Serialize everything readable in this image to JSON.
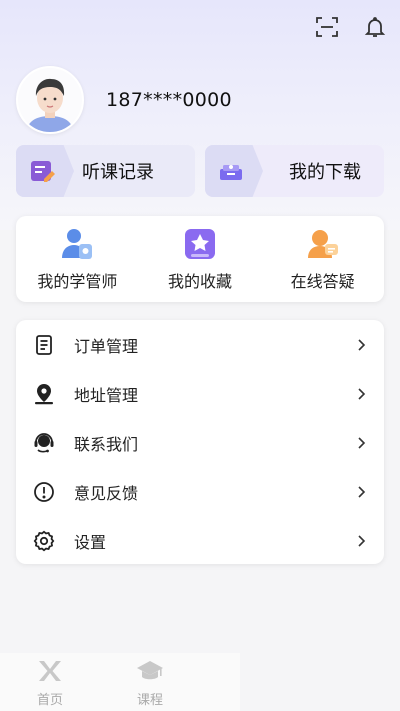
{
  "header": {
    "phone": "187****0000"
  },
  "quick_actions": [
    {
      "label": "听课记录",
      "icon": "listening-record-icon"
    },
    {
      "label": "我的下载",
      "icon": "download-box-icon"
    }
  ],
  "features": [
    {
      "label": "我的学管师",
      "icon": "tutor-icon"
    },
    {
      "label": "我的收藏",
      "icon": "favorites-star-icon"
    },
    {
      "label": "在线答疑",
      "icon": "online-qa-icon"
    }
  ],
  "menu": [
    {
      "label": "订单管理",
      "icon": "document-icon"
    },
    {
      "label": "地址管理",
      "icon": "location-icon"
    },
    {
      "label": "联系我们",
      "icon": "headset-icon"
    },
    {
      "label": "意见反馈",
      "icon": "exclamation-circle-icon"
    },
    {
      "label": "设置",
      "icon": "gear-icon"
    }
  ],
  "tabbar": [
    {
      "label": "首页",
      "icon": "home-logo-icon"
    },
    {
      "label": "课程",
      "icon": "graduation-cap-icon"
    }
  ],
  "colors": {
    "accent": "#7b6bef",
    "orange": "#f59a3b",
    "text": "#222222",
    "muted": "#aaaaaa"
  }
}
